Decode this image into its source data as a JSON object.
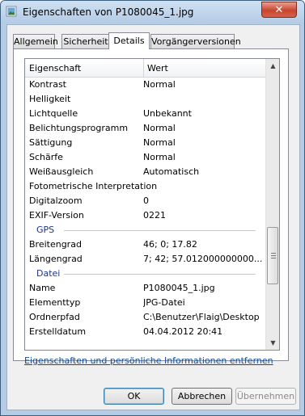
{
  "window": {
    "title": "Eigenschaften von P1080045_1.jpg",
    "close_glyph": "✕"
  },
  "tabs": [
    "Allgemein",
    "Sicherheit",
    "Details",
    "Vorgängerversionen"
  ],
  "list": {
    "columns": [
      "Eigenschaft",
      "Wert"
    ],
    "rows": [
      {
        "k": "Kontrast",
        "v": "Normal"
      },
      {
        "k": "Helligkeit",
        "v": ""
      },
      {
        "k": "Lichtquelle",
        "v": "Unbekannt"
      },
      {
        "k": "Belichtungsprogramm",
        "v": "Normal"
      },
      {
        "k": "Sättigung",
        "v": "Normal"
      },
      {
        "k": "Schärfe",
        "v": "Normal"
      },
      {
        "k": "Weißausgleich",
        "v": "Automatisch"
      },
      {
        "k": "Fotometrische Interpretation",
        "v": ""
      },
      {
        "k": "Digitalzoom",
        "v": "0"
      },
      {
        "k": "EXIF-Version",
        "v": "0221"
      },
      {
        "group": "GPS"
      },
      {
        "k": "Breitengrad",
        "v": "46; 0; 17.82"
      },
      {
        "k": "Längengrad",
        "v": "7; 42; 57.012000000000..."
      },
      {
        "group": "Datei"
      },
      {
        "k": "Name",
        "v": "P1080045_1.jpg"
      },
      {
        "k": "Elementtyp",
        "v": "JPG-Datei"
      },
      {
        "k": "Ordnerpfad",
        "v": "C:\\Benutzer\\Flaig\\Desktop"
      },
      {
        "k": "Erstelldatum",
        "v": "04.04.2012 20:41"
      }
    ]
  },
  "link": "Eigenschaften und persönliche Informationen entfernen",
  "buttons": {
    "ok": "OK",
    "cancel": "Abbrechen",
    "apply": "Übernehmen"
  },
  "icons": {
    "scroll_up": "▲",
    "scroll_down": "▼"
  }
}
